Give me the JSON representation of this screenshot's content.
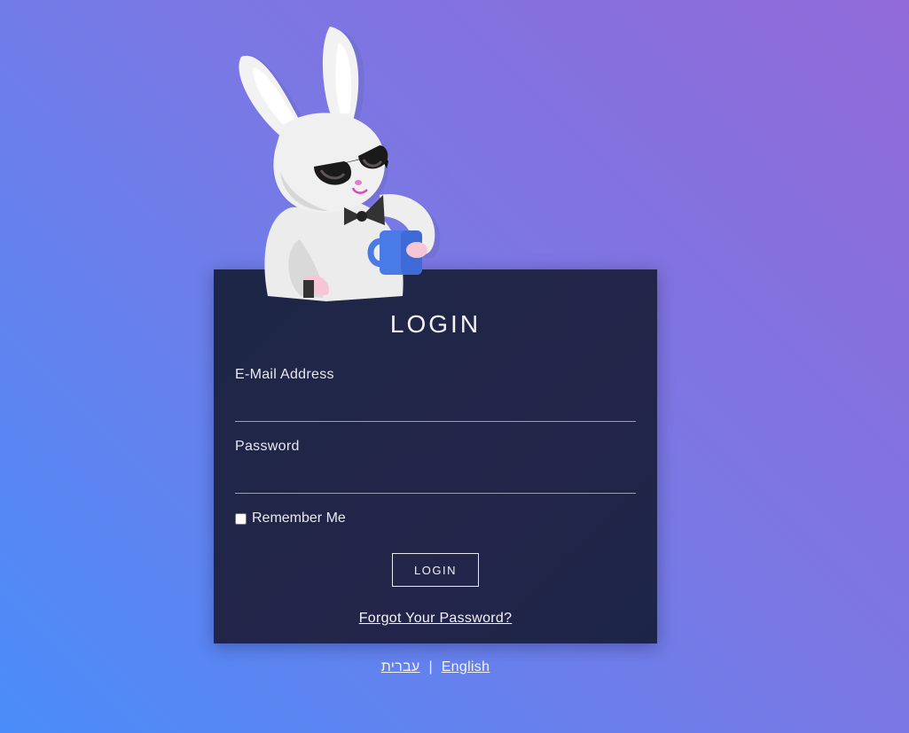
{
  "login": {
    "title": "LOGIN",
    "email_label": "E-Mail Address",
    "email_value": "",
    "password_label": "Password",
    "password_value": "",
    "remember_label": "Remember Me",
    "remember_checked": false,
    "button_label": "LOGIN",
    "forgot_label": "Forgot Your Password?"
  },
  "languages": {
    "hebrew": "עברית",
    "separator": "|",
    "english": "English"
  },
  "colors": {
    "background_start": "#9169d8",
    "background_end": "#4a8dfa",
    "card": "#1f2649",
    "mug": "#4a7ae6"
  },
  "icons": {
    "mascot": "bunny-with-sunglasses-and-mug-illustration"
  }
}
